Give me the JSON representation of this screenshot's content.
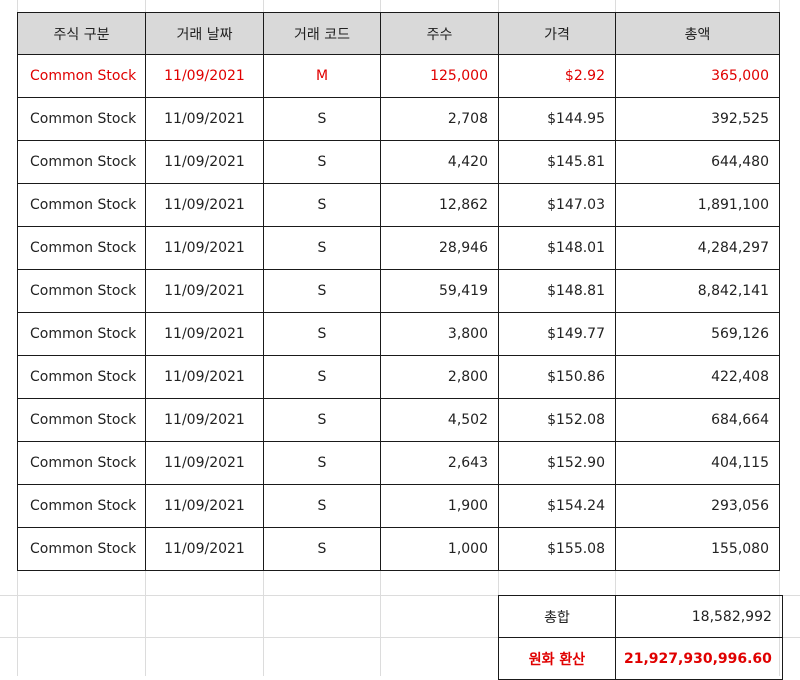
{
  "headers": [
    "주식 구분",
    "거래 날짜",
    "거래 코드",
    "주수",
    "가격",
    "총액"
  ],
  "rows": [
    {
      "type": "Common Stock",
      "date": "11/09/2021",
      "code": "M",
      "shares": "125,000",
      "price": "$2.92",
      "total": "365,000",
      "highlight": true
    },
    {
      "type": "Common Stock",
      "date": "11/09/2021",
      "code": "S",
      "shares": "2,708",
      "price": "$144.95",
      "total": "392,525"
    },
    {
      "type": "Common Stock",
      "date": "11/09/2021",
      "code": "S",
      "shares": "4,420",
      "price": "$145.81",
      "total": "644,480"
    },
    {
      "type": "Common Stock",
      "date": "11/09/2021",
      "code": "S",
      "shares": "12,862",
      "price": "$147.03",
      "total": "1,891,100"
    },
    {
      "type": "Common Stock",
      "date": "11/09/2021",
      "code": "S",
      "shares": "28,946",
      "price": "$148.01",
      "total": "4,284,297"
    },
    {
      "type": "Common Stock",
      "date": "11/09/2021",
      "code": "S",
      "shares": "59,419",
      "price": "$148.81",
      "total": "8,842,141"
    },
    {
      "type": "Common Stock",
      "date": "11/09/2021",
      "code": "S",
      "shares": "3,800",
      "price": "$149.77",
      "total": "569,126"
    },
    {
      "type": "Common Stock",
      "date": "11/09/2021",
      "code": "S",
      "shares": "2,800",
      "price": "$150.86",
      "total": "422,408"
    },
    {
      "type": "Common Stock",
      "date": "11/09/2021",
      "code": "S",
      "shares": "4,502",
      "price": "$152.08",
      "total": "684,664"
    },
    {
      "type": "Common Stock",
      "date": "11/09/2021",
      "code": "S",
      "shares": "2,643",
      "price": "$152.90",
      "total": "404,115"
    },
    {
      "type": "Common Stock",
      "date": "11/09/2021",
      "code": "S",
      "shares": "1,900",
      "price": "$154.24",
      "total": "293,056"
    },
    {
      "type": "Common Stock",
      "date": "11/09/2021",
      "code": "S",
      "shares": "1,000",
      "price": "$155.08",
      "total": "155,080"
    }
  ],
  "summary": {
    "total_label": "총합",
    "total_value": "18,582,992",
    "krw_label": "원화 환산",
    "krw_value": "21,927,930,996.60"
  },
  "colors": {
    "highlight": "#e00000",
    "header_bg": "#d9d9d9"
  }
}
